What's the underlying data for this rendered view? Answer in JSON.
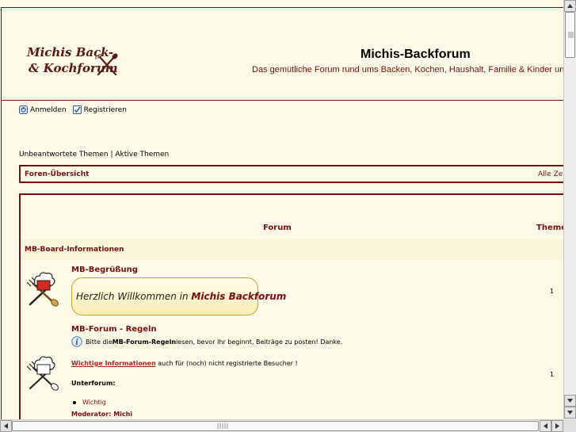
{
  "header": {
    "logo_line1": "Michis Back-",
    "logo_line2": "& Kochforum",
    "title": "Michis-Backforum",
    "description": "Das gemütliche Forum rund ums Backen, Kochen, Haushalt, Familie & Kinder und vieles m"
  },
  "usernav": {
    "login_label": "Anmelden",
    "register_label": "Registrieren"
  },
  "quicklinks": {
    "unanswered": "Unbeantwortete Themen",
    "separator": " | ",
    "active": "Aktive Themen"
  },
  "breadcrumb": {
    "index": "Foren-Übersicht",
    "times": "Alle Zeite"
  },
  "table": {
    "col_forum": "Forum",
    "col_topics": "Themen"
  },
  "category": {
    "name": "MB-Board-Informationen"
  },
  "forums": [
    {
      "title": "MB-Begrüßung",
      "welcome_prefix": "Herzlich Willkommen in ",
      "welcome_bold": "Michis Backforum",
      "topics": "1"
    },
    {
      "title": "MB-Forum - Regeln",
      "desc_prefix": "Bitte die ",
      "desc_bold": "MB-Forum-Regeln",
      "desc_suffix": " lesen, bevor Ihr beginnt, Beiträge zu posten! Danke.",
      "important_link": "Wichtige Informationen",
      "important_suffix": " auch für (noch) nicht registrierte Besucher !",
      "subforum_label": "Unterforum:",
      "subforum_item": "Wichtig",
      "moderator": "Moderator: Michi",
      "topics": "1"
    }
  ],
  "colors": {
    "accent": "#7a0e0e",
    "background": "#fdfbe8",
    "link_red": "#b3261e"
  }
}
